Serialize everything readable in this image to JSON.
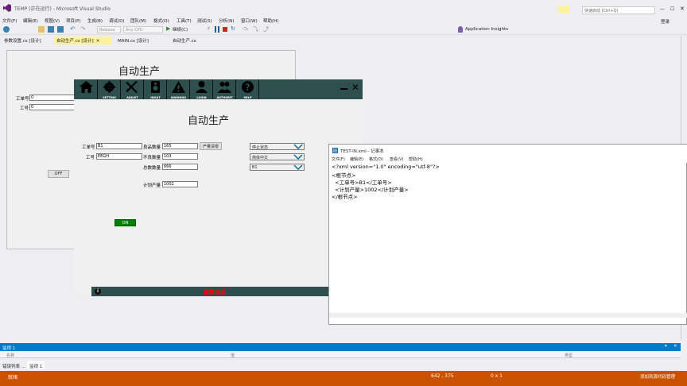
{
  "app": {
    "title": "TEMP (正在运行) - Microsoft Visual Studio",
    "quick_launch": "快速启动 (Ctrl+Q)",
    "login": "登录"
  },
  "menu": [
    "文件(F)",
    "编辑(E)",
    "视图(V)",
    "项目(P)",
    "生成(B)",
    "调试(D)",
    "团队(M)",
    "格式(O)",
    "工具(T)",
    "测试(S)",
    "分析(N)",
    "窗口(W)",
    "帮助(H)"
  ],
  "toolbar": {
    "config": "Release",
    "platform": "Any CPU",
    "continue": "继续(C)",
    "app_insights": "Application Insights"
  },
  "tabs": [
    {
      "label": "参数设置.cs [设计]",
      "active": false
    },
    {
      "label": "自动生产.cs [设计]",
      "active": true
    },
    {
      "label": "MAIN.cs [设计]",
      "active": false
    },
    {
      "label": "自动生产.cs",
      "active": false
    }
  ],
  "form1": {
    "title": "自动生产",
    "work_order_label": "工单号",
    "work_order_value": "0",
    "job_label": "工号",
    "job_value": "0",
    "off_button": "OFF"
  },
  "hmi": {
    "nav": [
      "",
      "SETTING",
      "ADJUST",
      "INOUT",
      "WARNING",
      "LOGIN",
      "AUTHORIT",
      "HELP"
    ],
    "title": "自动生产",
    "work_order_label": "工单号",
    "work_order_value": "B1",
    "job_label": "工号",
    "job_value": "EEGH",
    "good_label": "良品数量",
    "good_value": "165",
    "bad_label": "不良数量",
    "bad_value": "103",
    "total_label": "总数数量",
    "total_value": "666",
    "clear_button": "产量清零",
    "plan_label": "计划产量",
    "plan_value": "1002",
    "combo_state": "停止状态",
    "combo_lang": "简体中文",
    "combo_b1": "B1",
    "on_button": "ON",
    "alarm_text": "报警信息"
  },
  "notepad": {
    "title": "TEST-IN.xml - 记事本",
    "menu": [
      "文件(F)",
      "编辑(E)",
      "格式(O)",
      "查看(V)",
      "帮助(H)"
    ],
    "lines": [
      "<?xml version=\"1.0\" encoding=\"utf-8\"?>",
      "<根节点>",
      "  <工单号>B1</工单号>",
      "  <计划产量>1002</计划产量>",
      "</根节点>"
    ]
  },
  "watch": {
    "title": "监视 1",
    "col_name": "名称",
    "col_value": "值",
    "col_type": "类型",
    "tab_errors": "错误列表 ...",
    "tab_watch": "监视 1"
  },
  "status": {
    "left": "就绪",
    "position": "642 , 375",
    "size": "0 x 1",
    "source_control": "添加到源代码管理"
  },
  "colors": {
    "hmi_bar": "#2f4f4f",
    "status": "#ca5100",
    "on_button": "#008000",
    "alarm": "#ff0000"
  }
}
